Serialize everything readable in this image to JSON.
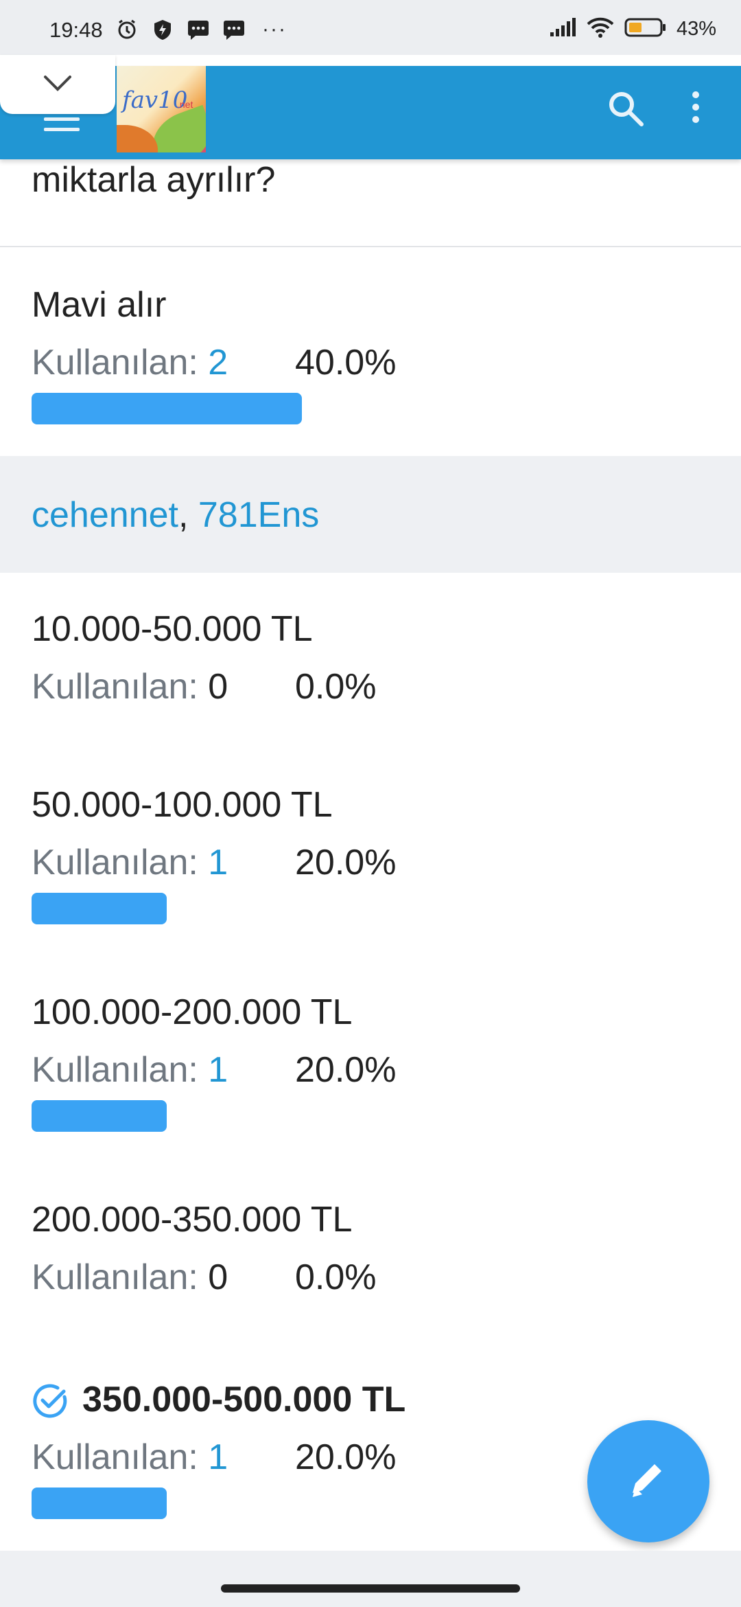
{
  "status_bar": {
    "time": "19:48",
    "battery_pct": "43%"
  },
  "app_bar": {
    "logo_text": "fav10",
    "logo_suffix": ".net"
  },
  "question": {
    "text_tail": "miktarla ayrılır?"
  },
  "options_top": [
    {
      "label": "Mavi alır",
      "used_label": "Kullanılan: ",
      "count": "2",
      "percent": "40.0%",
      "fraction": 0.4
    }
  ],
  "voters": {
    "users": [
      "cehennet",
      "781Ens"
    ],
    "separator": ", "
  },
  "options": [
    {
      "label": "10.000-50.000 TL",
      "used_label": "Kullanılan: ",
      "count": "0",
      "percent": "0.0%",
      "fraction": 0.0
    },
    {
      "label": "50.000-100.000 TL",
      "used_label": "Kullanılan: ",
      "count": "1",
      "percent": "20.0%",
      "fraction": 0.2
    },
    {
      "label": "100.000-200.000 TL",
      "used_label": "Kullanılan: ",
      "count": "1",
      "percent": "20.0%",
      "fraction": 0.2
    },
    {
      "label": "200.000-350.000 TL",
      "used_label": "Kullanılan: ",
      "count": "0",
      "percent": "0.0%",
      "fraction": 0.0
    },
    {
      "label": "350.000-500.000 TL",
      "used_label": "Kullanılan: ",
      "count": "1",
      "percent": "20.0%",
      "fraction": 0.2,
      "selected": true
    }
  ],
  "colors": {
    "accent": "#2196d3",
    "bar": "#3aa3f4"
  }
}
